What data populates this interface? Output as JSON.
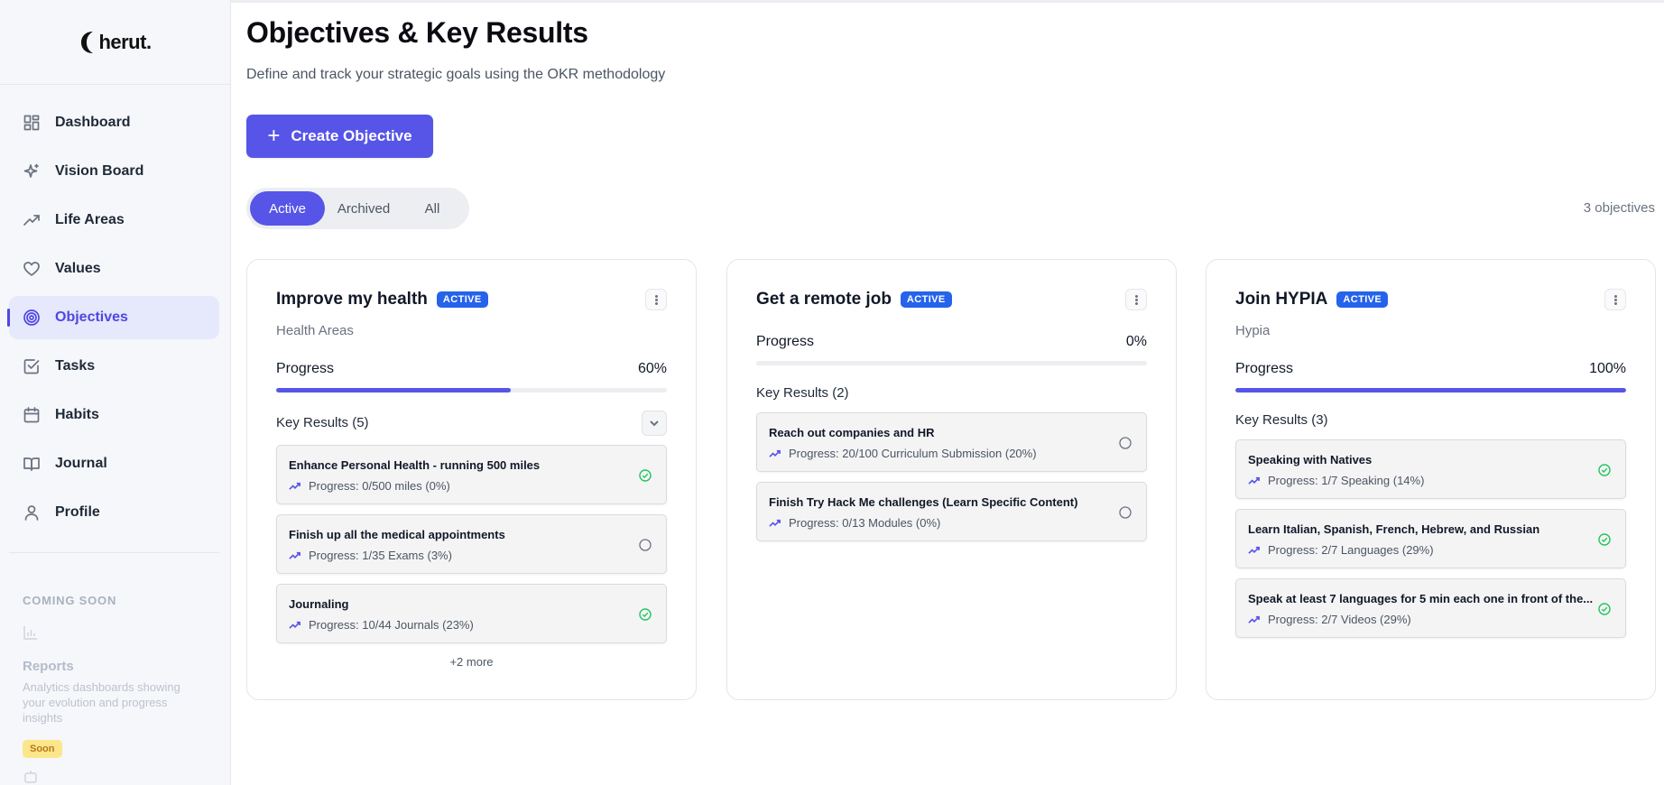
{
  "brand": {
    "name": "herut."
  },
  "sidebar": {
    "items": [
      {
        "label": "Dashboard"
      },
      {
        "label": "Vision Board"
      },
      {
        "label": "Life Areas"
      },
      {
        "label": "Values"
      },
      {
        "label": "Objectives"
      },
      {
        "label": "Tasks"
      },
      {
        "label": "Habits"
      },
      {
        "label": "Journal"
      },
      {
        "label": "Profile"
      }
    ],
    "active_index": 4,
    "coming_soon": {
      "heading": "COMING SOON",
      "title": "Reports",
      "description": "Analytics dashboards showing your evolution and progress insights",
      "badge": "Soon"
    }
  },
  "header": {
    "title": "Objectives & Key Results",
    "subtitle": "Define and track your strategic goals using the OKR methodology"
  },
  "create_button": {
    "label": "Create Objective"
  },
  "filters": {
    "options": [
      "Active",
      "Archived",
      "All"
    ],
    "selected": "Active"
  },
  "objective_count": "3 objectives",
  "progress_label": "Progress",
  "colors": {
    "accent": "#5655e8",
    "badge": "#2563eb",
    "success": "#22c55e"
  },
  "cards": [
    {
      "title": "Improve my health",
      "badge": "ACTIVE",
      "area": "Health Areas",
      "progress_text": "60%",
      "progress": 0.6,
      "kr_heading": "Key Results (5)",
      "key_results": [
        {
          "title": "Enhance Personal Health - running 500 miles",
          "progress": "Progress: 0/500 miles (0%)",
          "status": "done"
        },
        {
          "title": "Finish up all the medical appointments",
          "progress": "Progress: 1/35 Exams (3%)",
          "status": "open"
        },
        {
          "title": "Journaling",
          "progress": "Progress: 10/44 Journals (23%)",
          "status": "done"
        }
      ],
      "more": "+2 more"
    },
    {
      "title": "Get a remote job",
      "badge": "ACTIVE",
      "area": "",
      "progress_text": "0%",
      "progress": 0,
      "kr_heading": "Key Results (2)",
      "key_results": [
        {
          "title": "Reach out companies and HR",
          "progress": "Progress: 20/100 Curriculum Submission (20%)",
          "status": "open"
        },
        {
          "title": "Finish Try Hack Me challenges (Learn Specific Content)",
          "progress": "Progress: 0/13 Modules (0%)",
          "status": "open"
        }
      ],
      "more": ""
    },
    {
      "title": "Join HYPIA",
      "badge": "ACTIVE",
      "area": "Hypia",
      "progress_text": "100%",
      "progress": 1,
      "kr_heading": "Key Results (3)",
      "key_results": [
        {
          "title": "Speaking with Natives",
          "progress": "Progress: 1/7 Speaking (14%)",
          "status": "done"
        },
        {
          "title": "Learn Italian, Spanish, French, Hebrew, and Russian",
          "progress": "Progress: 2/7 Languages (29%)",
          "status": "done"
        },
        {
          "title": "Speak at least 7 languages for 5 min each one in front of the...",
          "progress": "Progress: 2/7 Videos (29%)",
          "status": "done"
        }
      ],
      "more": ""
    }
  ]
}
